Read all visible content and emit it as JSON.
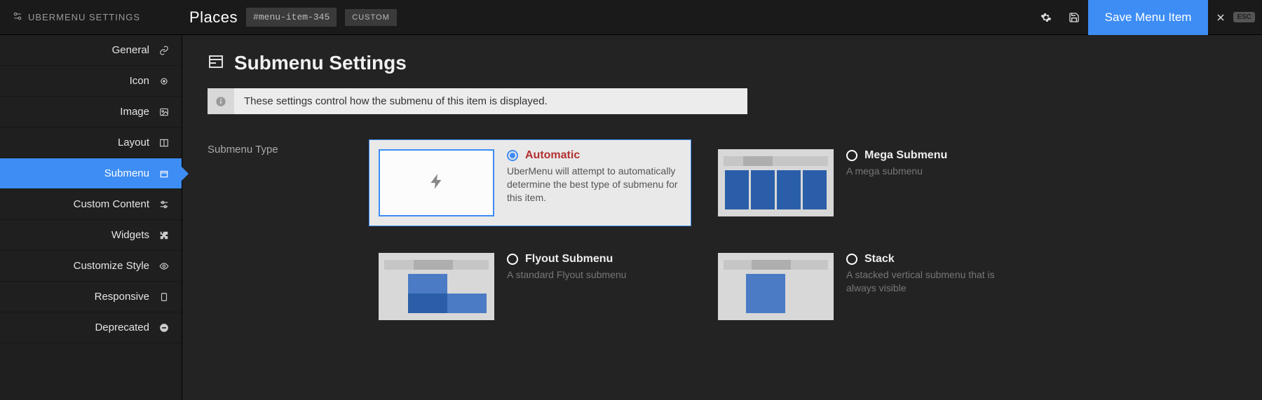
{
  "app": {
    "title": "UBERMENU SETTINGS"
  },
  "breadcrumb": {
    "current": "Places",
    "id": "#menu-item-345",
    "type_tag": "CUSTOM"
  },
  "actions": {
    "save": "Save Menu Item",
    "esc": "ESC"
  },
  "sidebar": {
    "items": [
      {
        "label": "General",
        "icon": "link"
      },
      {
        "label": "Icon",
        "icon": "target"
      },
      {
        "label": "Image",
        "icon": "image"
      },
      {
        "label": "Layout",
        "icon": "columns"
      },
      {
        "label": "Submenu",
        "icon": "box",
        "active": true
      },
      {
        "label": "Custom Content",
        "icon": "sliders"
      },
      {
        "label": "Widgets",
        "icon": "puzzle"
      },
      {
        "label": "Customize Style",
        "icon": "eye"
      },
      {
        "label": "Responsive",
        "icon": "tablet"
      },
      {
        "label": "Deprecated",
        "icon": "minus"
      }
    ]
  },
  "page": {
    "title": "Submenu Settings",
    "info": "These settings control how the submenu of this item is displayed.",
    "field_label": "Submenu Type"
  },
  "options": [
    {
      "key": "automatic",
      "title": "Automatic",
      "desc": "UberMenu will attempt to automatically determine the best type of submenu for this item.",
      "selected": true
    },
    {
      "key": "mega",
      "title": "Mega Submenu",
      "desc": "A mega submenu",
      "selected": false
    },
    {
      "key": "flyout",
      "title": "Flyout Submenu",
      "desc": "A standard Flyout submenu",
      "selected": false
    },
    {
      "key": "stack",
      "title": "Stack",
      "desc": "A stacked vertical submenu that is always visible",
      "selected": false
    }
  ]
}
